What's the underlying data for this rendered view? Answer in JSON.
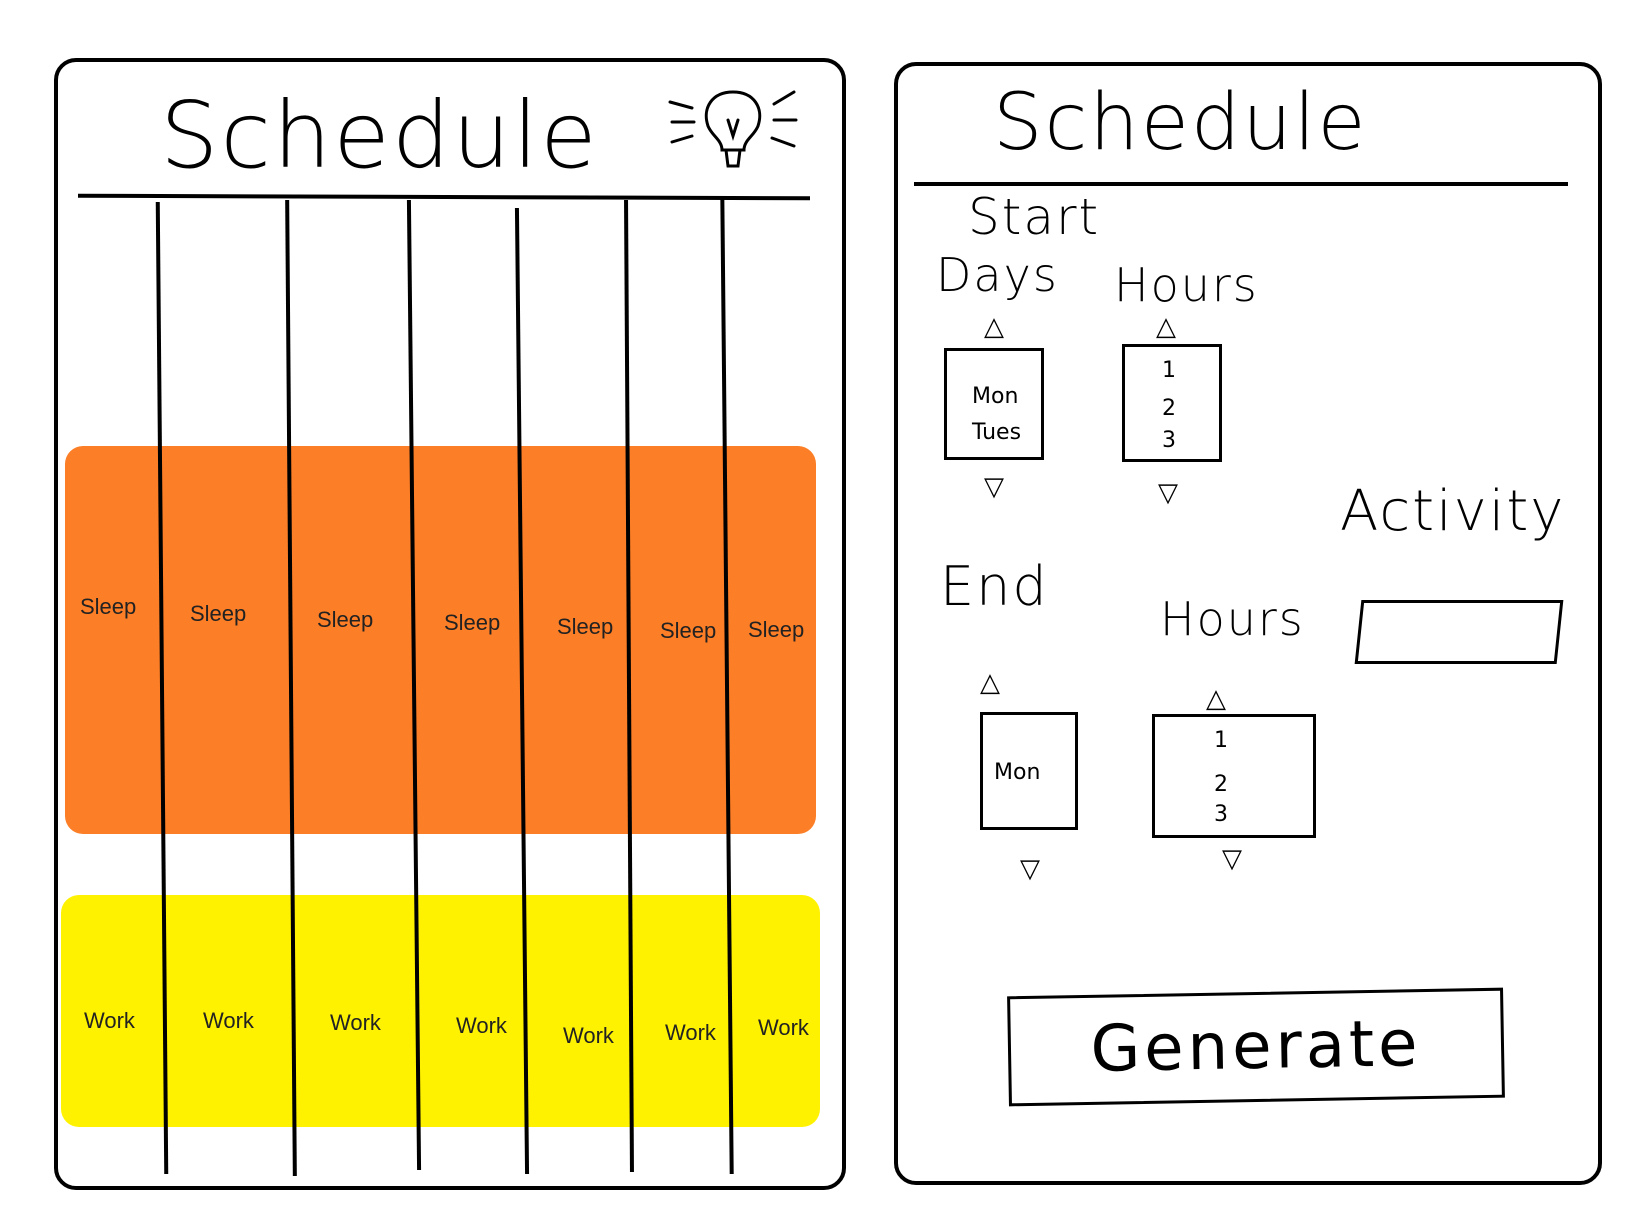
{
  "left": {
    "title": "Schedule",
    "bulb_icon": "lightbulb-icon",
    "sleep_label": "Sleep",
    "work_label": "Work",
    "days": 7
  },
  "right": {
    "title": "Schedule",
    "start_label": "Start",
    "days_label": "Days",
    "hours_label": "Hours",
    "start_days": [
      "Mon",
      "Tues"
    ],
    "start_hours": [
      "1",
      "2",
      "3"
    ],
    "activity_label": "Activity",
    "activity_value": "",
    "end_label": "End",
    "end_hours_label": "Hours",
    "end_days": [
      "Mon"
    ],
    "end_hours": [
      "1",
      "2",
      "3"
    ],
    "generate_label": "Generate"
  },
  "colors": {
    "sleep": "#FC7E26",
    "work": "#FFF200"
  }
}
